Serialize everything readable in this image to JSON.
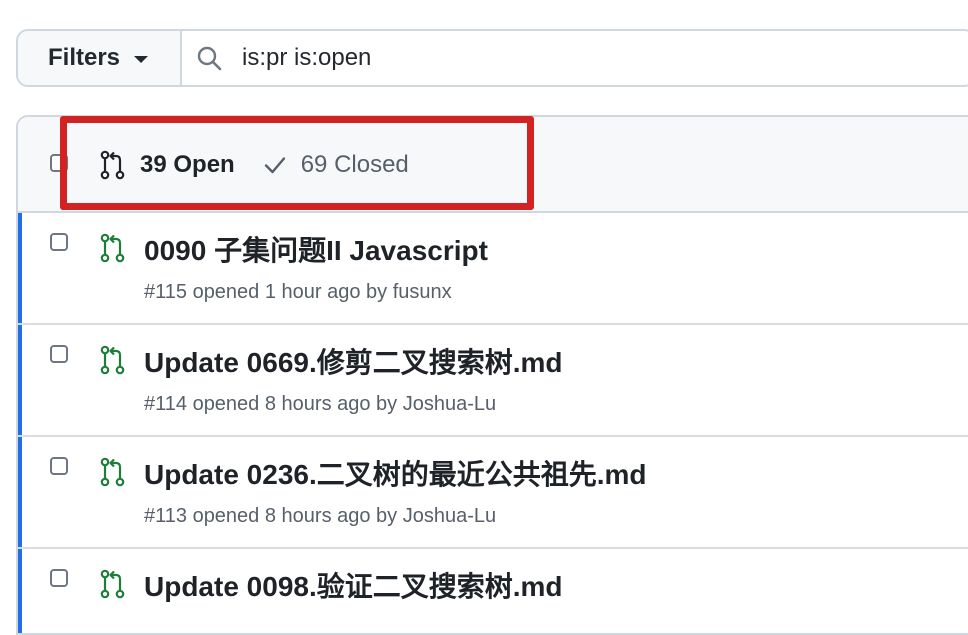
{
  "filters": {
    "button_label": "Filters",
    "search_value": "is:pr is:open"
  },
  "tabs": {
    "open_label": "39 Open",
    "closed_label": "69 Closed"
  },
  "colors": {
    "open_icon": "#1a7f37",
    "row_accent": "#1f6feb",
    "highlight": "#d32222"
  },
  "pull_requests": [
    {
      "title": "0090 子集问题II Javascript",
      "meta": "#115 opened 1 hour ago by fusunx"
    },
    {
      "title": "Update 0669.修剪二叉搜索树.md",
      "meta": "#114 opened 8 hours ago by Joshua-Lu"
    },
    {
      "title": "Update 0236.二叉树的最近公共祖先.md",
      "meta": "#113 opened 8 hours ago by Joshua-Lu"
    },
    {
      "title": "Update 0098.验证二叉搜索树.md",
      "meta": ""
    }
  ]
}
